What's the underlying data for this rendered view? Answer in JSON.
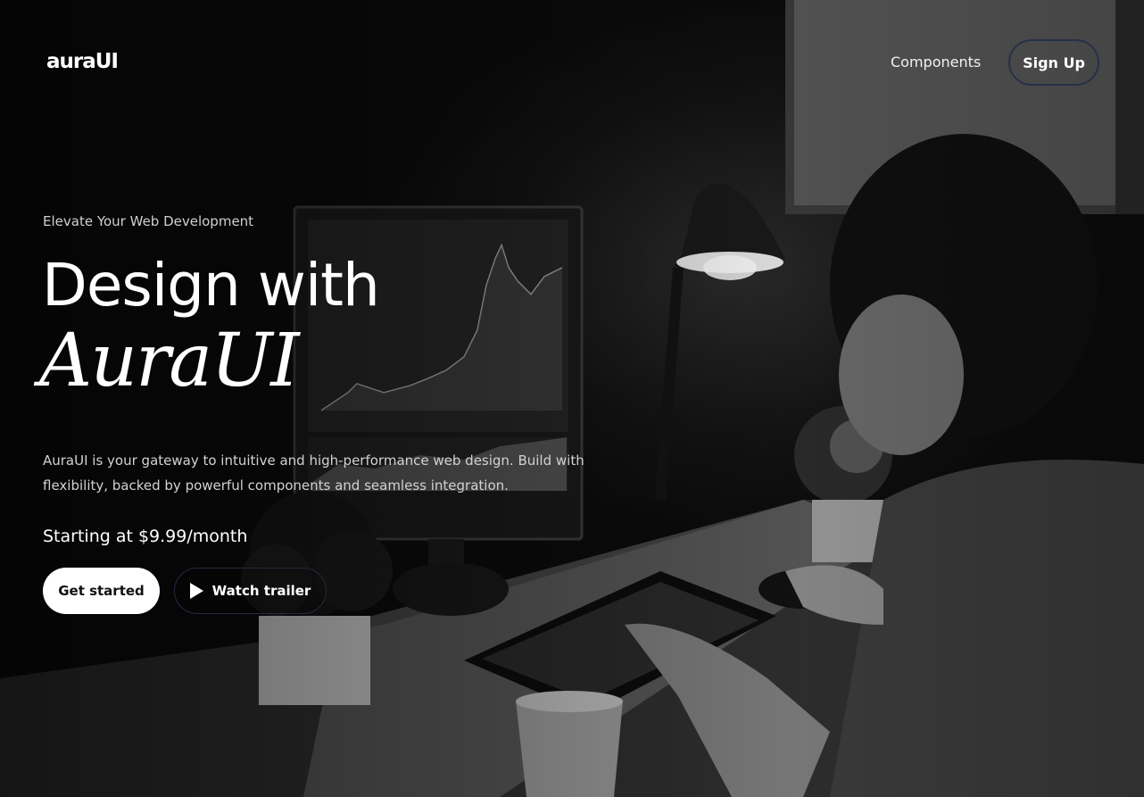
{
  "header": {
    "logo_text": "auraUI",
    "nav_components": "Components",
    "signup_label": "Sign Up"
  },
  "hero": {
    "eyebrow": "Elevate Your Web Development",
    "headline_line1": "Design with",
    "headline_line2": "AuraUI",
    "description": "AuraUI is your gateway to intuitive and high-performance web design. Build with flexibility, backed by powerful components and seamless integration.",
    "price": "Starting at $9.99/month",
    "cta_primary": "Get started",
    "cta_secondary": "Watch trailer"
  },
  "icons": {
    "play": "play-icon"
  },
  "colors": {
    "background": "#0e0e0e",
    "text": "#ffffff",
    "muted_text": "#cfcfcf",
    "button_bg": "#ffffff",
    "button_text": "#111111",
    "outline": "#26304a"
  }
}
